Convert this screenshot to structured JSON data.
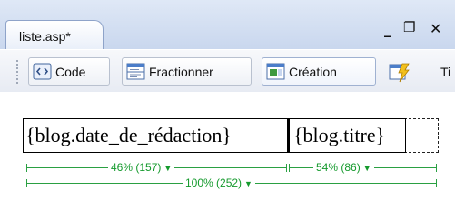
{
  "document_tab": {
    "label": "liste.asp*"
  },
  "window_controls": {
    "minimize": "_",
    "restore": "❐",
    "close": "✕"
  },
  "toolbar": {
    "code_label": "Code",
    "split_label": "Fractionner",
    "design_label": "Création",
    "title_label_partial": "Ti"
  },
  "design": {
    "cells": [
      {
        "text": "{blog.date_de_rédaction}"
      },
      {
        "text": "{blog.titre}"
      }
    ],
    "widths": {
      "col1": "46% (157)",
      "col2": "54% (86)",
      "table": "100% (252)"
    }
  },
  "colors": {
    "measure": "#2aa042",
    "tab_bar": "#c9d7ee"
  }
}
